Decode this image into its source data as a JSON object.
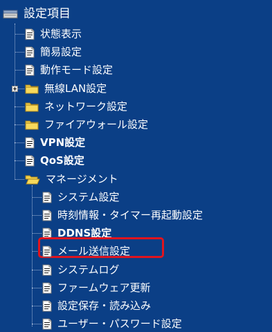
{
  "tree": {
    "root_label": "設定項目",
    "items": [
      {
        "label": "状態表示"
      },
      {
        "label": "簡易設定"
      },
      {
        "label": "動作モード設定"
      },
      {
        "label": "無線LAN設定"
      },
      {
        "label": "ネットワーク設定"
      },
      {
        "label": "ファイアウォール設定"
      },
      {
        "label": "VPN設定"
      },
      {
        "label": "QoS設定"
      },
      {
        "label": "マネージメント"
      }
    ],
    "management_items": [
      {
        "label": "システム設定"
      },
      {
        "label": "時刻情報・タイマー再起動設定"
      },
      {
        "label": "DDNS設定"
      },
      {
        "label": "メール送信設定"
      },
      {
        "label": "システムログ"
      },
      {
        "label": "ファームウェア更新"
      },
      {
        "label": "設定保存・読み込み"
      },
      {
        "label": "ユーザー・パスワード設定"
      }
    ]
  },
  "colors": {
    "background": "#0b3f86",
    "highlight": "#e0141e",
    "folder": "#f2cf4a",
    "document": "#ffffff"
  }
}
